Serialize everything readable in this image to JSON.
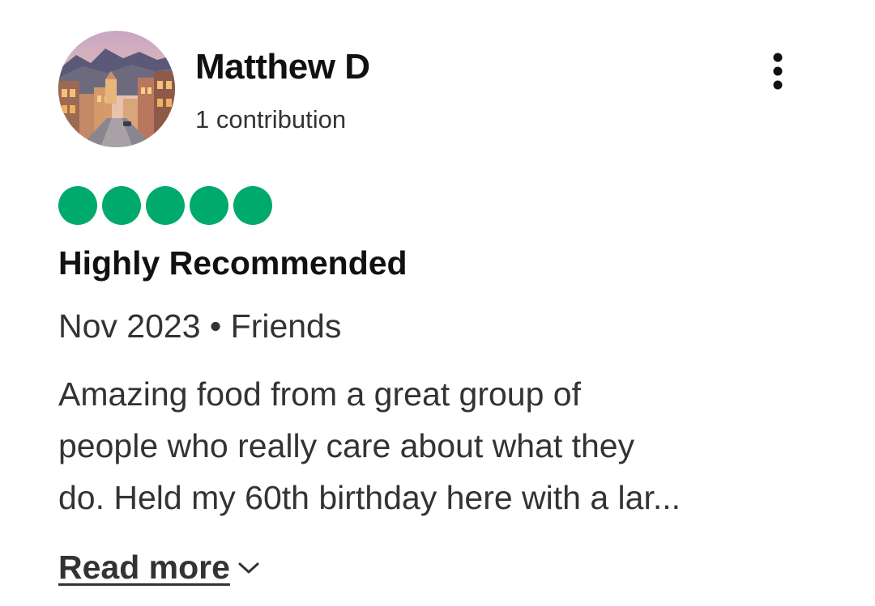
{
  "review": {
    "user": {
      "name": "Matthew D",
      "contributions": "1 contribution",
      "avatar_icon": "street-town-photo-icon"
    },
    "menu_icon": "vertical-ellipsis-icon",
    "rating": {
      "value": 5,
      "max": 5,
      "bubble_color": "#00aa6c"
    },
    "title": "Highly Recommended",
    "meta": "Nov 2023 • Friends",
    "body_lines": [
      "Amazing food from a great group of",
      "people who really care about what they",
      "do. Held my 60th birthday here with a lar..."
    ],
    "read_more": {
      "label": "Read more",
      "icon": "chevron-down-icon"
    }
  }
}
